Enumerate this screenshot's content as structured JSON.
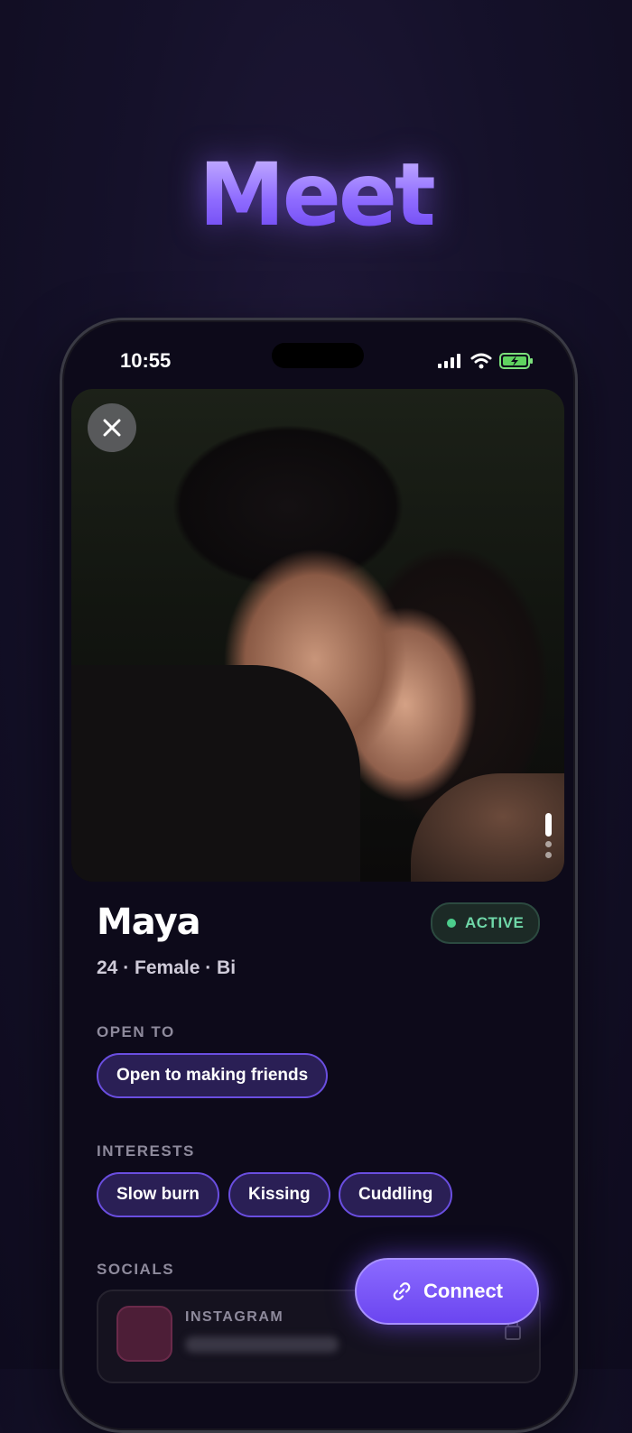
{
  "hero": {
    "title": "Meet"
  },
  "status_bar": {
    "time": "10:55"
  },
  "profile": {
    "name": "Maya",
    "status_badge": "ACTIVE",
    "meta": "24 · Female · Bi",
    "photo_count": 3,
    "active_photo_index": 1
  },
  "open_to": {
    "label": "OPEN TO",
    "chips": [
      "Open to making friends"
    ]
  },
  "interests": {
    "label": "INTERESTS",
    "chips": [
      "Slow burn",
      "Kissing",
      "Cuddling"
    ]
  },
  "socials": {
    "label": "SOCIALS",
    "items": [
      {
        "platform": "INSTAGRAM"
      }
    ]
  },
  "actions": {
    "connect_label": "Connect"
  },
  "icons": {
    "close": "close-icon",
    "link": "link-icon",
    "lock": "lock-icon"
  },
  "colors": {
    "accent": "#7c5cff",
    "active_green": "#4ccd8c",
    "chip_border": "#6a4ee0"
  }
}
